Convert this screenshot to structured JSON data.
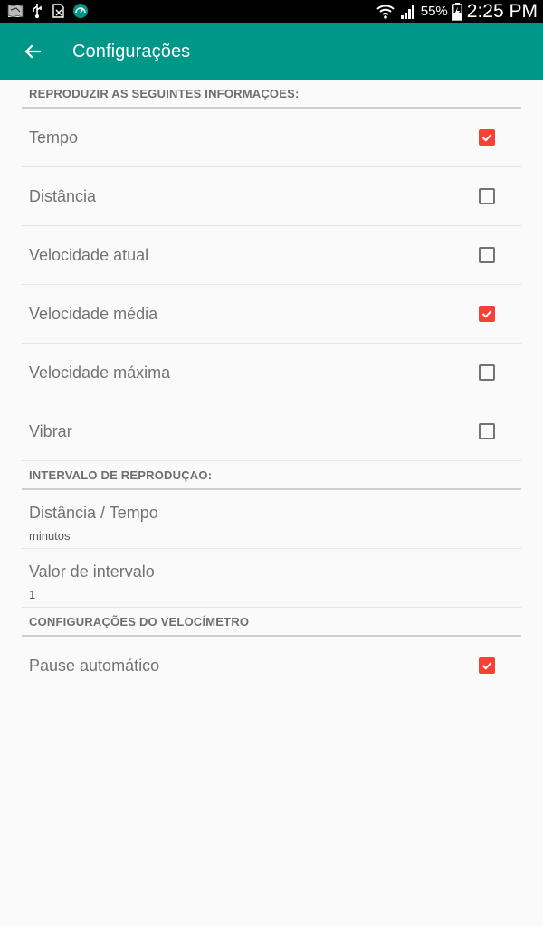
{
  "status_bar": {
    "battery_percent": "55%",
    "time": "2:25 PM",
    "icons": [
      "maps-icon",
      "usb-icon",
      "no-sim-icon",
      "app-speedometer-icon",
      "wifi-icon",
      "signal-icon",
      "battery-charging-icon"
    ]
  },
  "toolbar": {
    "title": "Configurações",
    "back_icon": "arrow-back-icon"
  },
  "sections": [
    {
      "title": "REPRODUZIR AS SEGUINTES INFORMAÇOES:",
      "items": [
        {
          "label": "Tempo",
          "checked": true
        },
        {
          "label": "Distância",
          "checked": false
        },
        {
          "label": "Velocidade atual",
          "checked": false
        },
        {
          "label": "Velocidade média",
          "checked": true
        },
        {
          "label": "Velocidade máxima",
          "checked": false
        },
        {
          "label": "Vibrar",
          "checked": false
        }
      ]
    },
    {
      "title": "INTERVALO DE REPRODUÇAO:",
      "items": [
        {
          "label": "Distância / Tempo",
          "summary": "minutos"
        },
        {
          "label": "Valor de intervalo",
          "summary": "1"
        }
      ]
    },
    {
      "title": "CONFIGURAÇÕES DO VELOCÍMETRO",
      "items": [
        {
          "label": "Pause automático",
          "checked": true
        }
      ]
    }
  ],
  "colors": {
    "toolbar": "#009688",
    "checkbox_checked": "#f44336",
    "text": "#737373"
  }
}
